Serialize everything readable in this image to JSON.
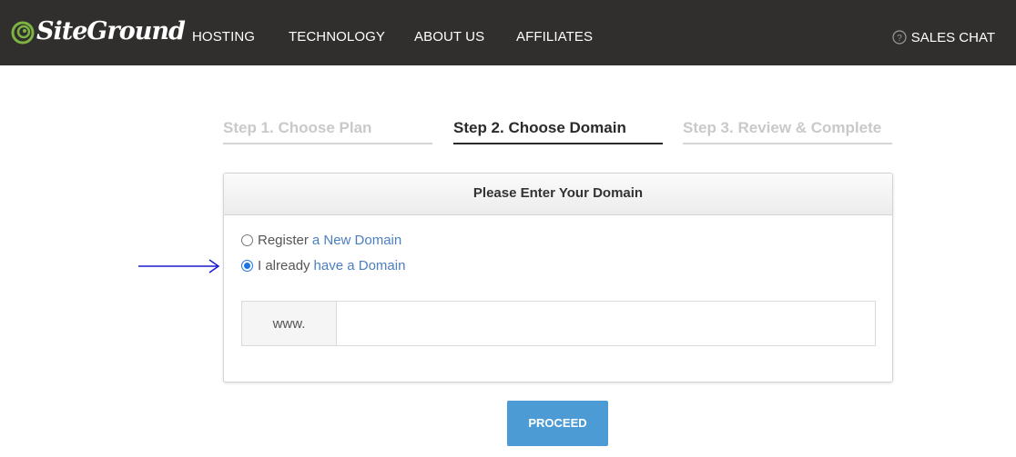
{
  "brand": {
    "name": "SiteGround",
    "logo_icon": "siteground-swirl-icon",
    "accent": "#7cb342"
  },
  "nav": {
    "items": [
      {
        "label": "HOSTING"
      },
      {
        "label": "TECHNOLOGY"
      },
      {
        "label": "ABOUT US"
      },
      {
        "label": "AFFILIATES"
      }
    ],
    "sales_chat": {
      "label": "SALES CHAT",
      "icon": "question-circle-icon"
    }
  },
  "steps": [
    {
      "label": "Step 1. Choose Plan",
      "state": "inactive"
    },
    {
      "label": "Step 2. Choose Domain",
      "state": "active"
    },
    {
      "label": "Step 3. Review & Complete",
      "state": "inactive"
    }
  ],
  "panel": {
    "title": "Please Enter Your Domain",
    "options": [
      {
        "prefix": "Register",
        "link": "a New Domain",
        "checked": false
      },
      {
        "prefix": "I already",
        "link": "have a Domain",
        "checked": true
      }
    ],
    "domain_field": {
      "prefix": "www.",
      "value": "",
      "placeholder": ""
    }
  },
  "proceed_button": {
    "label": "PROCEED",
    "color": "#4d9bd5"
  },
  "annotation": {
    "icon": "right-arrow-icon",
    "color": "#1a1ad0"
  }
}
